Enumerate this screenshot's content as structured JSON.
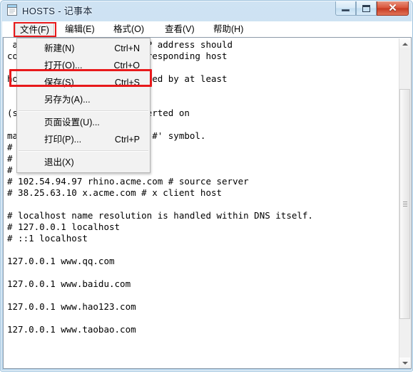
{
  "window": {
    "title": "HOSTS - 记事本",
    "icon": "notepad-icon",
    "controls": {
      "minimize_label": "–",
      "maximize_label": "□",
      "close_label": "✕"
    }
  },
  "menubar": {
    "items": [
      {
        "label": "文件(F)",
        "name": "file"
      },
      {
        "label": "编辑(E)",
        "name": "edit"
      },
      {
        "label": "格式(O)",
        "name": "format"
      },
      {
        "label": "查看(V)",
        "name": "view"
      },
      {
        "label": "帮助(H)",
        "name": "help"
      }
    ]
  },
  "file_menu": {
    "items": [
      {
        "label": "新建(N)",
        "accel": "Ctrl+N"
      },
      {
        "label": "打开(O)...",
        "accel": "Ctrl+O"
      },
      {
        "label": "保存(S)",
        "accel": "Ctrl+S"
      },
      {
        "label": "另存为(A)...",
        "accel": ""
      },
      {
        "label": "页面设置(U)...",
        "accel": ""
      },
      {
        "label": "打印(P)...",
        "accel": "Ctrl+P"
      },
      {
        "label": "退出(X)",
        "accel": ""
      }
    ]
  },
  "annotations": {
    "highlight_color": "#e8191b",
    "file_menu_box": "文件(F)",
    "save_item_box": "保存(S)"
  },
  "editor": {
    "content": " an individual line. The IP address should\ncolumn followed by the corresponding host\n\nhost name should be separated by at least\n\n\n(such as these) may be inserted on\n\nmachine name denoted by a '#' symbol.\n#\n# For example:\n#\n# 102.54.94.97 rhino.acme.com # source server\n# 38.25.63.10 x.acme.com # x client host\n\n# localhost name resolution is handled within DNS itself.\n# 127.0.0.1 localhost\n# ::1 localhost\n\n127.0.0.1 www.qq.com\n\n127.0.0.1 www.baidu.com\n\n127.0.0.1 www.hao123.com\n\n127.0.0.1 www.taobao.com"
  },
  "scrollbar": {
    "up_arrow": "scroll-up-icon",
    "down_arrow": "scroll-down-icon",
    "thumb": "scroll-thumb"
  }
}
